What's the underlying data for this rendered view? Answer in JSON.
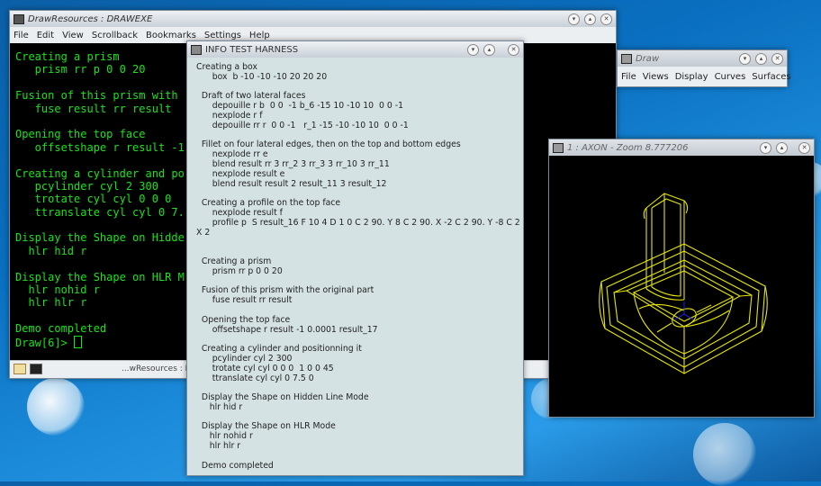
{
  "drawexe": {
    "title": "DrawResources : DRAWEXE",
    "menu": [
      "File",
      "Edit",
      "View",
      "Scrollback",
      "Bookmarks",
      "Settings",
      "Help"
    ],
    "terminal_lines": [
      "Creating a prism",
      "   prism rr p 0 0 20",
      "",
      "Fusion of this prism with",
      "   fuse result rr result",
      "",
      "Opening the top face",
      "   offsetshape r result -1",
      "",
      "Creating a cylinder and po",
      "   pcylinder cyl 2 300",
      "   trotate cyl cyl 0 0 0",
      "   ttranslate cyl cyl 0 7.",
      "",
      "Display the Shape on Hidde",
      "  hlr hid r",
      "",
      "Display the Shape on HLR M",
      "  hlr nohid r",
      "  hlr hlr r",
      "",
      "Demo completed",
      "Draw[6]> "
    ],
    "taskbar_tab": "...wResources : D"
  },
  "info": {
    "title": "INFO TEST HARNESS",
    "lines": [
      "Creating a box",
      "      box  b -10 -10 -10 20 20 20",
      "",
      "  Draft of two lateral faces",
      "      depouille r b  0 0  -1 b_6 -15 10 -10 10  0 0 -1",
      "      nexplode r f",
      "      depouille rr r  0 0 -1   r_1 -15 -10 -10 10  0 0 -1",
      "",
      "  Fillet on four lateral edges, then on the top and bottom edges",
      "      nexplode rr e",
      "      blend result rr 3 rr_2 3 rr_3 3 rr_10 3 rr_11",
      "      nexplode result e",
      "      blend result result 2 result_11 3 result_12",
      "",
      "  Creating a profile on the top face",
      "      nexplode result f",
      "      profile p  S result_16 F 10 4 D 1 0 C 2 90. Y 8 C 2 90. X -2 C 2 90. Y -8 C 2 90.",
      "X 2",
      "",
      "",
      "  Creating a prism",
      "      prism rr p 0 0 20",
      "",
      "  Fusion of this prism with the original part",
      "      fuse result rr result",
      "",
      "  Opening the top face",
      "      offsetshape r result -1 0.0001 result_17",
      "",
      "  Creating a cylinder and positionning it",
      "      pcylinder cyl 2 300",
      "      trotate cyl cyl 0 0 0  1 0 0 45",
      "      ttranslate cyl cyl 0 7.5 0",
      "",
      "  Display the Shape on Hidden Line Mode",
      "     hlr hid r",
      "",
      "  Display the Shape on HLR Mode",
      "     hlr nohid r",
      "     hlr hlr r",
      "",
      "  Demo completed"
    ]
  },
  "draw": {
    "title": "Draw",
    "menu": [
      "File",
      "Views",
      "Display",
      "Curves",
      "Surfaces"
    ]
  },
  "axon": {
    "title": "1 : AXON - Zoom 8.777206"
  },
  "colors": {
    "terminal_text": "#19e419",
    "wireframe": "#e6e600",
    "axis": "#2020ff"
  }
}
